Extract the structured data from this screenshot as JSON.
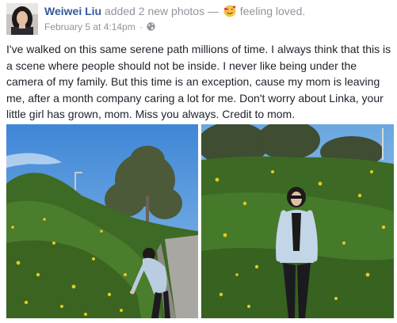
{
  "post": {
    "author": "Weiwei Liu",
    "action": "added 2 new photos",
    "separator": "—",
    "feeling_icon": "smiling-face-with-hearts-emoji",
    "feeling": "feeling loved.",
    "timestamp": "February 5 at 4:14pm",
    "dot": "·",
    "privacy_icon": "globe-icon",
    "text": "I've walked on this same serene path millions of time. I always think that this is a scene where people should not be inside. I never like being under the camera of my family. But this time is an exception, cause my mom is leaving me, after a month company caring a lot for me. Don't worry about Linka, your little girl has grown, mom. Miss you always. Credit to mom."
  },
  "colors": {
    "author_link": "#365899",
    "meta_gray": "#90949c",
    "body_text": "#1d2129",
    "sky": "#4a90d9",
    "foliage": "#3f6b25",
    "flowers": "#e8c81e"
  }
}
